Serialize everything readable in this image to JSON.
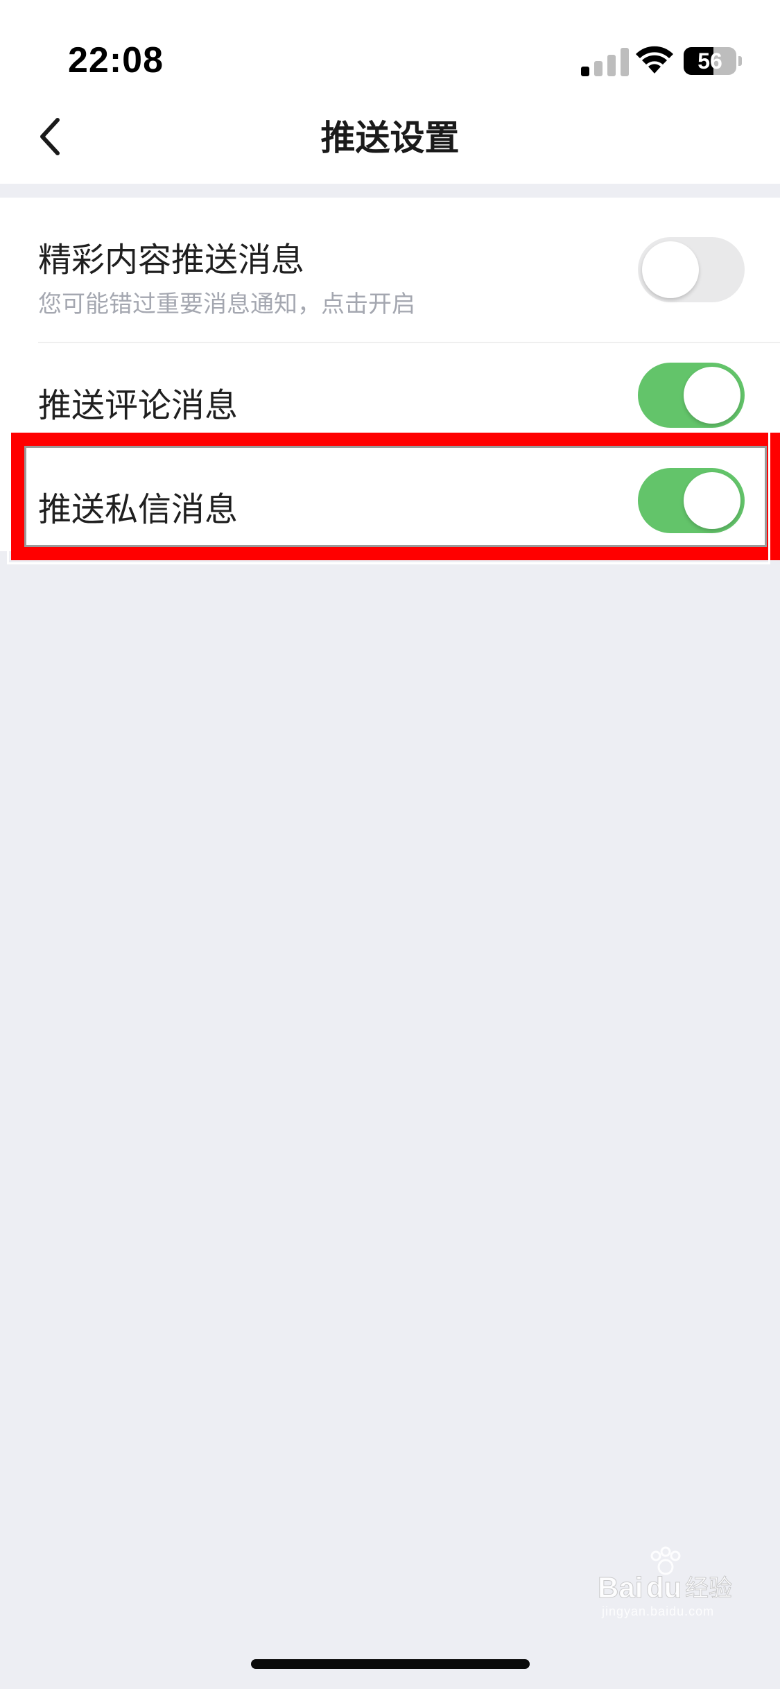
{
  "status_bar": {
    "time": "22:08",
    "battery_level": "56",
    "battery_fraction": 0.56,
    "signal_icon": "cellular-signal-icon",
    "wifi_icon": "wifi-icon",
    "battery_icon": "battery-icon"
  },
  "nav": {
    "back_icon": "chevron-left-icon",
    "title": "推送设置"
  },
  "settings": [
    {
      "title": "精彩内容推送消息",
      "subtitle": "您可能错过重要消息通知，点击开启",
      "enabled": false
    },
    {
      "title": "推送评论消息",
      "enabled": true
    },
    {
      "title": "推送私信消息",
      "enabled": true
    }
  ],
  "watermark": {
    "brand": "Baidu经验",
    "url": "jingyan.baidu.com"
  },
  "colors": {
    "toggle_on": "#63C46A",
    "toggle_off": "#E9E9EA",
    "page_background": "#EDEEF3",
    "highlight": "#FF0000",
    "subtitle_text": "#A4A7B0"
  }
}
